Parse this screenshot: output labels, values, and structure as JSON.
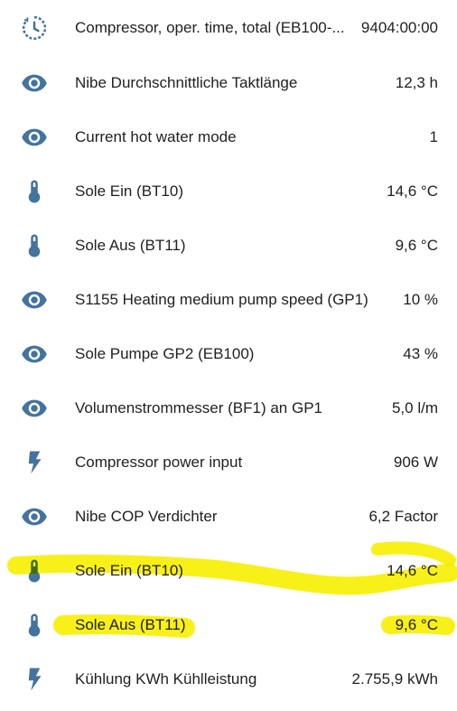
{
  "colors": {
    "icon": "#44739e",
    "text": "#212121",
    "highlight": "#f7ee00"
  },
  "rows": [
    {
      "icon": "timer-clock-icon",
      "label": "Compressor, oper. time, total (EB100-...",
      "value": "9404:00:00"
    },
    {
      "icon": "eye-icon",
      "label": "Nibe Durchschnittliche Taktlänge",
      "value": "12,3 h"
    },
    {
      "icon": "eye-icon",
      "label": "Current hot water mode",
      "value": "1"
    },
    {
      "icon": "thermometer-icon",
      "label": "Sole Ein (BT10)",
      "value": "14,6 °C"
    },
    {
      "icon": "thermometer-icon",
      "label": "Sole Aus (BT11)",
      "value": "9,6 °C"
    },
    {
      "icon": "eye-icon",
      "label": "S1155 Heating medium pump speed (GP1)",
      "value": "10 %"
    },
    {
      "icon": "eye-icon",
      "label": "Sole Pumpe GP2 (EB100)",
      "value": "43 %"
    },
    {
      "icon": "eye-icon",
      "label": "Volumenstrommesser (BF1) an GP1",
      "value": "5,0 l/m"
    },
    {
      "icon": "flash-icon",
      "label": "Compressor power input",
      "value": "906 W"
    },
    {
      "icon": "eye-icon",
      "label": "Nibe COP Verdichter",
      "value": "6,2 Factor"
    },
    {
      "icon": "thermometer-icon",
      "label": "Sole Ein (BT10)",
      "value": "14,6 °C"
    },
    {
      "icon": "thermometer-icon",
      "label": "Sole Aus (BT11)",
      "value": "9,6 °C"
    },
    {
      "icon": "flash-icon",
      "label": "Kühlung KWh Kühlleistung",
      "value": "2.755,9 kWh"
    }
  ]
}
